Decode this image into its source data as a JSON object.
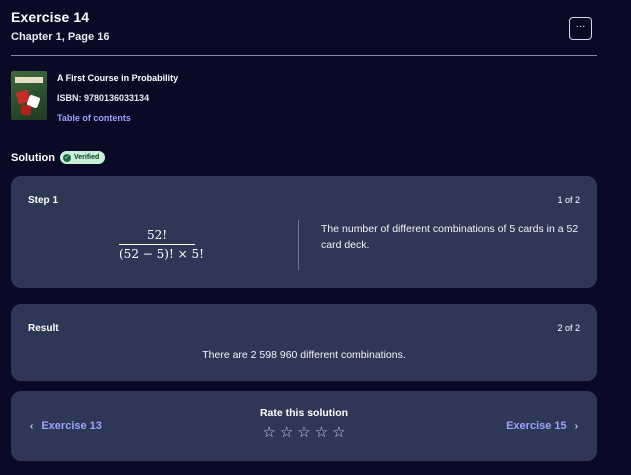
{
  "header": {
    "title": "Exercise 14",
    "subtitle": "Chapter 1, Page 16",
    "more_label": "···"
  },
  "book": {
    "title": "A First Course in Probability",
    "isbn": "ISBN: 9780136033134",
    "toc_link": "Table of contents"
  },
  "solution": {
    "label": "Solution",
    "badge": "Verified"
  },
  "step": {
    "title": "Step 1",
    "count": "1 of 2",
    "formula_numerator": "52!",
    "formula_denominator": "(52 − 5)! × 5!",
    "explanation": "The number of different combinations of 5 cards in a 52 card deck."
  },
  "result": {
    "title": "Result",
    "count": "2 of 2",
    "text": "There are 2 598 960 different combinations."
  },
  "nav": {
    "prev_label": "Exercise 13",
    "next_label": "Exercise 15",
    "rate_label": "Rate this solution",
    "stars": [
      "☆",
      "☆",
      "☆",
      "☆",
      "☆"
    ]
  },
  "colors": {
    "background": "#0b0a26",
    "card": "#2e3856",
    "link": "#9aa4ff",
    "verified_badge": "#c7f0d8"
  },
  "icons": {
    "more": "more-horizontal-icon",
    "prev": "chevron-left-icon",
    "next": "chevron-right-icon",
    "verified": "check-circle-icon",
    "star": "star-outline-icon"
  }
}
